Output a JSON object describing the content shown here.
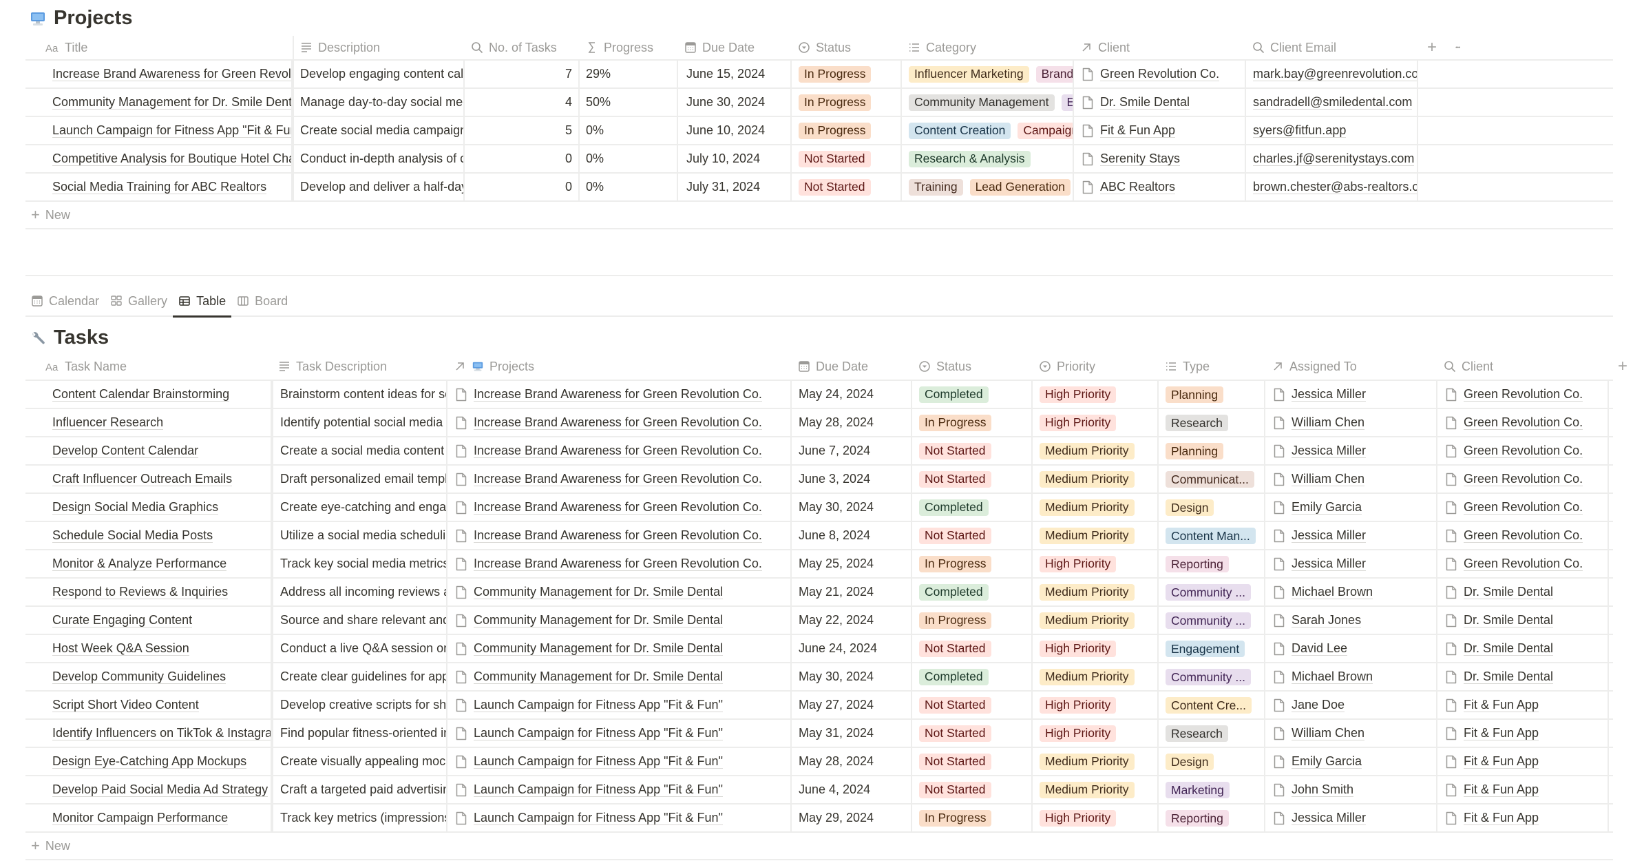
{
  "projects": {
    "title": "Projects",
    "icon": "desktop-computer-icon",
    "columns": [
      {
        "label": "Title",
        "icon": "text-aa-icon"
      },
      {
        "label": "Description",
        "icon": "text-lines-icon"
      },
      {
        "label": "No. of Tasks",
        "icon": "search-rollup-icon"
      },
      {
        "label": "Progress",
        "icon": "sigma-formula-icon"
      },
      {
        "label": "Due Date",
        "icon": "calendar-icon"
      },
      {
        "label": "Status",
        "icon": "status-icon"
      },
      {
        "label": "Category",
        "icon": "multi-select-icon"
      },
      {
        "label": "Client",
        "icon": "relation-arrow-icon"
      },
      {
        "label": "Client Email",
        "icon": "search-rollup-icon"
      }
    ],
    "rows": [
      {
        "title": "Increase Brand Awareness for Green Revolution Co.",
        "description": "Develop engaging content calendar",
        "tasks": "7",
        "progress": "29%",
        "due": "June 15, 2024",
        "status": {
          "label": "In Progress",
          "color": "orange"
        },
        "categories": [
          {
            "label": "Influencer Marketing",
            "color": "yellow"
          },
          {
            "label": "Brand",
            "color": "pink"
          }
        ],
        "client": "Green Revolution Co.",
        "email": "mark.bay@greenrevolution.co"
      },
      {
        "title": "Community Management for Dr. Smile Dental",
        "description": "Manage day-to-day social media",
        "tasks": "4",
        "progress": "50%",
        "due": "June 30, 2024",
        "status": {
          "label": "In Progress",
          "color": "orange"
        },
        "categories": [
          {
            "label": "Community Management",
            "color": "gray"
          },
          {
            "label": "E",
            "color": "purple"
          }
        ],
        "client": "Dr. Smile Dental",
        "email": "sandradell@smiledental.com"
      },
      {
        "title": "Launch Campaign for Fitness App \"Fit & Fun\"",
        "description": "Create social media campaign",
        "tasks": "5",
        "progress": "0%",
        "due": "June 10, 2024",
        "status": {
          "label": "In Progress",
          "color": "orange"
        },
        "categories": [
          {
            "label": "Content Creation",
            "color": "blue"
          },
          {
            "label": "Campaign",
            "color": "red"
          }
        ],
        "client": "Fit & Fun App",
        "email": "syers@fitfun.app"
      },
      {
        "title": "Competitive Analysis for Boutique Hotel Chain",
        "description": "Conduct in-depth analysis of co",
        "tasks": "0",
        "progress": "0%",
        "due": "July 10, 2024",
        "status": {
          "label": "Not Started",
          "color": "red"
        },
        "categories": [
          {
            "label": "Research & Analysis",
            "color": "green"
          }
        ],
        "client": "Serenity Stays",
        "email": "charles.jf@serenitystays.com"
      },
      {
        "title": "Social Media Training for ABC Realtors",
        "description": "Develop and deliver a half-day",
        "tasks": "0",
        "progress": "0%",
        "due": "July 31, 2024",
        "status": {
          "label": "Not Started",
          "color": "red"
        },
        "categories": [
          {
            "label": "Training",
            "color": "brown"
          },
          {
            "label": "Lead Generation",
            "color": "orange"
          }
        ],
        "client": "ABC Realtors",
        "email": "brown.chester@abs-realtors.co"
      }
    ],
    "new_label": "New",
    "add_column_icon": "plus-icon",
    "more_icon": "ellipsis-icon"
  },
  "views": {
    "tabs": [
      {
        "label": "Calendar",
        "icon": "calendar-icon",
        "active": false
      },
      {
        "label": "Gallery",
        "icon": "gallery-grid-icon",
        "active": false
      },
      {
        "label": "Table",
        "icon": "table-icon",
        "active": true
      },
      {
        "label": "Board",
        "icon": "board-columns-icon",
        "active": false
      }
    ]
  },
  "tasks": {
    "title": "Tasks",
    "icon": "wrench-icon",
    "columns": [
      {
        "label": "Task Name",
        "icon": "text-aa-icon"
      },
      {
        "label": "Task Description",
        "icon": "text-lines-icon"
      },
      {
        "label": "Projects",
        "icon": "relation-arrow-icon"
      },
      {
        "label": "Due Date",
        "icon": "calendar-icon"
      },
      {
        "label": "Status",
        "icon": "status-icon"
      },
      {
        "label": "Priority",
        "icon": "status-icon"
      },
      {
        "label": "Type",
        "icon": "multi-select-icon"
      },
      {
        "label": "Assigned To",
        "icon": "relation-arrow-icon"
      },
      {
        "label": "Client",
        "icon": "search-rollup-icon"
      }
    ],
    "rows": [
      {
        "name": "Content Calendar Brainstorming",
        "description": "Brainstorm content ideas for so",
        "project": "Increase Brand Awareness for Green Revolution Co.",
        "due": "May 24, 2024",
        "status": {
          "label": "Completed",
          "color": "green"
        },
        "priority": {
          "label": "High Priority",
          "color": "red"
        },
        "type": {
          "label": "Planning",
          "color": "orange"
        },
        "assigned": "Jessica Miller",
        "client": "Green Revolution Co."
      },
      {
        "name": "Influencer Research",
        "description": "Identify potential social media in",
        "project": "Increase Brand Awareness for Green Revolution Co.",
        "due": "May 28, 2024",
        "status": {
          "label": "In Progress",
          "color": "orange"
        },
        "priority": {
          "label": "High Priority",
          "color": "red"
        },
        "type": {
          "label": "Research",
          "color": "gray"
        },
        "assigned": "William Chen",
        "client": "Green Revolution Co."
      },
      {
        "name": "Develop Content Calendar",
        "description": "Create a social media content c",
        "project": "Increase Brand Awareness for Green Revolution Co.",
        "due": "June 7, 2024",
        "status": {
          "label": "Not Started",
          "color": "red"
        },
        "priority": {
          "label": "Medium Priority",
          "color": "yellow"
        },
        "type": {
          "label": "Planning",
          "color": "orange"
        },
        "assigned": "Jessica Miller",
        "client": "Green Revolution Co."
      },
      {
        "name": "Craft Influencer Outreach Emails",
        "description": "Draft personalized email templa",
        "project": "Increase Brand Awareness for Green Revolution Co.",
        "due": "June 3, 2024",
        "status": {
          "label": "Not Started",
          "color": "red"
        },
        "priority": {
          "label": "Medium Priority",
          "color": "yellow"
        },
        "type": {
          "label": "Communicat...",
          "color": "brown"
        },
        "assigned": "William Chen",
        "client": "Green Revolution Co."
      },
      {
        "name": "Design Social Media Graphics",
        "description": "Create eye-catching and engag",
        "project": "Increase Brand Awareness for Green Revolution Co.",
        "due": "May 30, 2024",
        "status": {
          "label": "Completed",
          "color": "green"
        },
        "priority": {
          "label": "Medium Priority",
          "color": "yellow"
        },
        "type": {
          "label": "Design",
          "color": "yellow"
        },
        "assigned": "Emily Garcia",
        "client": "Green Revolution Co."
      },
      {
        "name": "Schedule Social Media Posts",
        "description": "Utilize a social media schedulin",
        "project": "Increase Brand Awareness for Green Revolution Co.",
        "due": "June 8, 2024",
        "status": {
          "label": "Not Started",
          "color": "red"
        },
        "priority": {
          "label": "Medium Priority",
          "color": "yellow"
        },
        "type": {
          "label": "Content Man...",
          "color": "blue"
        },
        "assigned": "Jessica Miller",
        "client": "Green Revolution Co."
      },
      {
        "name": "Monitor & Analyze Performance",
        "description": "Track key social media metrics",
        "project": "Increase Brand Awareness for Green Revolution Co.",
        "due": "May 25, 2024",
        "status": {
          "label": "In Progress",
          "color": "orange"
        },
        "priority": {
          "label": "High Priority",
          "color": "red"
        },
        "type": {
          "label": "Reporting",
          "color": "pink"
        },
        "assigned": "Jessica Miller",
        "client": "Green Revolution Co."
      },
      {
        "name": "Respond to Reviews & Inquiries",
        "description": "Address all incoming reviews an",
        "project": "Community Management for Dr. Smile Dental",
        "due": "May 21, 2024",
        "status": {
          "label": "Completed",
          "color": "green"
        },
        "priority": {
          "label": "Medium Priority",
          "color": "yellow"
        },
        "type": {
          "label": "Community ...",
          "color": "purple"
        },
        "assigned": "Michael Brown",
        "client": "Dr. Smile Dental"
      },
      {
        "name": "Curate Engaging Content",
        "description": "Source and share relevant and",
        "project": "Community Management for Dr. Smile Dental",
        "due": "May 22, 2024",
        "status": {
          "label": "In Progress",
          "color": "orange"
        },
        "priority": {
          "label": "Medium Priority",
          "color": "yellow"
        },
        "type": {
          "label": "Community ...",
          "color": "purple"
        },
        "assigned": "Sarah Jones",
        "client": "Dr. Smile Dental"
      },
      {
        "name": "Host Week Q&A Session",
        "description": "Conduct a live Q&A session on",
        "project": "Community Management for Dr. Smile Dental",
        "due": "June 24, 2024",
        "status": {
          "label": "Not Started",
          "color": "red"
        },
        "priority": {
          "label": "High Priority",
          "color": "red"
        },
        "type": {
          "label": "Engagement",
          "color": "blue"
        },
        "assigned": "David Lee",
        "client": "Dr. Smile Dental"
      },
      {
        "name": "Develop Community Guidelines",
        "description": "Create clear guidelines for appr",
        "project": "Community Management for Dr. Smile Dental",
        "due": "May 30, 2024",
        "status": {
          "label": "Completed",
          "color": "green"
        },
        "priority": {
          "label": "Medium Priority",
          "color": "yellow"
        },
        "type": {
          "label": "Community ...",
          "color": "purple"
        },
        "assigned": "Michael Brown",
        "client": "Dr. Smile Dental"
      },
      {
        "name": "Script Short Video Content",
        "description": "Develop creative scripts for sho",
        "project": "Launch Campaign for Fitness App \"Fit & Fun\"",
        "due": "May 27, 2024",
        "status": {
          "label": "Not Started",
          "color": "red"
        },
        "priority": {
          "label": "High Priority",
          "color": "red"
        },
        "type": {
          "label": "Content Cre...",
          "color": "yellow"
        },
        "assigned": "Jane Doe",
        "client": "Fit & Fun App"
      },
      {
        "name": "Identify Influencers on TikTok & Instagram",
        "description": "Find popular fitness-oriented int",
        "project": "Launch Campaign for Fitness App \"Fit & Fun\"",
        "due": "May 31, 2024",
        "status": {
          "label": "Not Started",
          "color": "red"
        },
        "priority": {
          "label": "High Priority",
          "color": "red"
        },
        "type": {
          "label": "Research",
          "color": "gray"
        },
        "assigned": "William Chen",
        "client": "Fit & Fun App"
      },
      {
        "name": "Design Eye-Catching App Mockups",
        "description": "Create visually appealing mock",
        "project": "Launch Campaign for Fitness App \"Fit & Fun\"",
        "due": "May 28, 2024",
        "status": {
          "label": "Not Started",
          "color": "red"
        },
        "priority": {
          "label": "Medium Priority",
          "color": "yellow"
        },
        "type": {
          "label": "Design",
          "color": "yellow"
        },
        "assigned": "Emily Garcia",
        "client": "Fit & Fun App"
      },
      {
        "name": "Develop Paid Social Media Ad Strategy",
        "description": "Craft a targeted paid advertising",
        "project": "Launch Campaign for Fitness App \"Fit & Fun\"",
        "due": "June 4, 2024",
        "status": {
          "label": "Not Started",
          "color": "red"
        },
        "priority": {
          "label": "Medium Priority",
          "color": "yellow"
        },
        "type": {
          "label": "Marketing",
          "color": "purple"
        },
        "assigned": "John Smith",
        "client": "Fit & Fun App"
      },
      {
        "name": "Monitor Campaign Performance",
        "description": "Track key metrics (impressions,",
        "project": "Launch Campaign for Fitness App \"Fit & Fun\"",
        "due": "May 29, 2024",
        "status": {
          "label": "In Progress",
          "color": "orange"
        },
        "priority": {
          "label": "High Priority",
          "color": "red"
        },
        "type": {
          "label": "Reporting",
          "color": "pink"
        },
        "assigned": "Jessica Miller",
        "client": "Fit & Fun App"
      }
    ],
    "new_label": "New",
    "add_column_icon": "plus-icon"
  }
}
